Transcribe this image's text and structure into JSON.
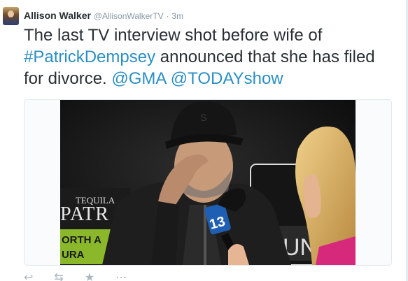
{
  "tweet": {
    "author_name": "Allison Walker",
    "author_handle": "@AllisonWalkerTV",
    "separator": "·",
    "time": "3m",
    "text_before": "The last TV interview shot before wife of ",
    "hashtag": "#PatrickDempsey",
    "text_after": " announced that she has filed for divorce. ",
    "mention_1": "@GMA",
    "mention_2": "@TODAYshow",
    "link_color": "#2a8fc4"
  },
  "media": {
    "sign_brand_line1": "TEQUILA",
    "sign_brand_line2": "PATR",
    "sign_green_line1": "ORTH A",
    "sign_green_line2": "URA",
    "mic_channel_number": "13",
    "right_sign_text": "UN",
    "cap_logo": "S"
  },
  "actions": {
    "reply_icon": "reply-icon",
    "retweet_icon": "retweet-icon",
    "favorite_icon": "star-icon",
    "more_icon": "more-icon"
  }
}
